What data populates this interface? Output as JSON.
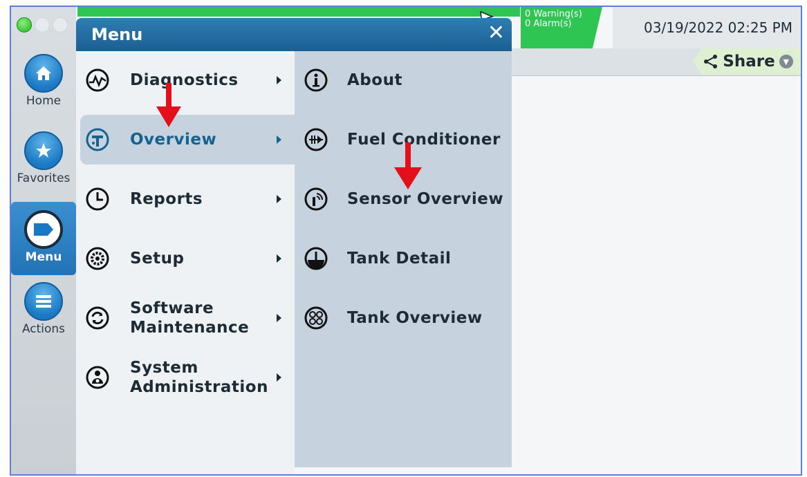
{
  "status": {
    "warnings": "0 Warning(s)",
    "alarms": "0 Alarm(s)",
    "datetime": "03/19/2022 02:25 PM"
  },
  "toolbar": {
    "share_label": "Share"
  },
  "nav": {
    "home": "Home",
    "favorites": "Favorites",
    "menu": "Menu",
    "actions": "Actions"
  },
  "menu": {
    "title": "Menu",
    "close": "✕",
    "items": [
      {
        "label": "Diagnostics",
        "icon": "diagnostics-icon"
      },
      {
        "label": "Overview",
        "icon": "overview-icon",
        "selected": true
      },
      {
        "label": "Reports",
        "icon": "clock-icon"
      },
      {
        "label": "Setup",
        "icon": "gear-icon"
      },
      {
        "label": "Software\nMaintenance",
        "icon": "sync-icon"
      },
      {
        "label": "System\nAdministration",
        "icon": "admin-icon"
      }
    ],
    "submenu": [
      {
        "label": "About",
        "icon": "info-icon"
      },
      {
        "label": "Fuel Conditioner",
        "icon": "fuel-conditioner-icon"
      },
      {
        "label": "Sensor Overview",
        "icon": "sensor-icon"
      },
      {
        "label": "Tank Detail",
        "icon": "tank-detail-icon"
      },
      {
        "label": "Tank Overview",
        "icon": "tank-overview-icon"
      }
    ]
  },
  "colors": {
    "status_green": "#2fc553",
    "menu_header": "#1b5f93",
    "submenu_bg": "#c6d2de",
    "annotation_red": "#e3101b"
  }
}
